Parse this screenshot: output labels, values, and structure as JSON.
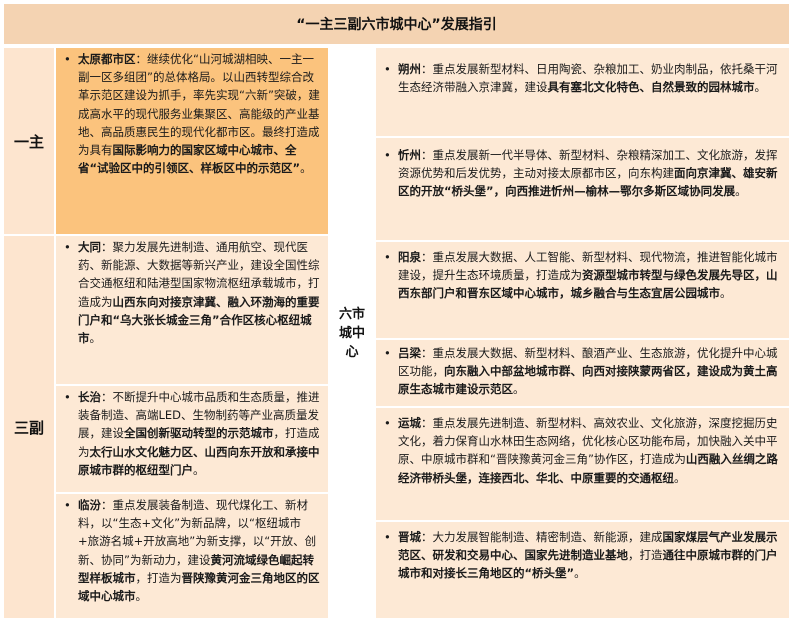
{
  "title": "“一主三副六市城中心”发展指引",
  "labels": {
    "yizhu": "一主",
    "sanfu": "三副",
    "liushi": [
      "六市",
      "城中",
      "心"
    ]
  },
  "bullet_char": "•",
  "cells": {
    "taiyuan": {
      "name": "太原都市区",
      "p1": "：继续优化“山河城湖相映、一主一副一区多组团”的总体格局。以山西转型综合改革示范区建设为抓手，率先实现“六新”突破，建成高水平的现代服务业集聚区、高能级的产业基地、高品质惠民生的现代化都市区。最终打造成为具有",
      "b1": "国际影响力的国家区域中心城市、全省“试验区中的引领区、样板区中的示范区”",
      "p2": "。"
    },
    "datong": {
      "name": "大同",
      "p1": "：聚力发展先进制造、通用航空、现代医药、新能源、大数据等新兴产业，建设全国性综合交通枢纽和陆港型国家物流枢纽承载城市，打造成为",
      "b1": "山西东向对接京津冀、融入环渤海的重要门户和“乌大张长城金三角”合作区核心枢纽城市",
      "p2": "。"
    },
    "changzhi": {
      "name": "长治",
      "p1": "：不断提升中心城市品质和生态质量，推进装备制造、高端LED、生物制药等产业高质量发展，建设",
      "b1": "全国创新驱动转型的示范城市",
      "p2": "，打造成为",
      "b2": "太行山水文化魅力区、山西向东开放和承接中原城市群的枢纽型门户",
      "p3": "。"
    },
    "linfen": {
      "name": "临汾",
      "p1": "：重点发展装备制造、现代煤化工、新材料，以“生态+文化”为新品牌，以“枢纽城市+旅游名城+开放高地”为新支撑，以“开放、创新、协同”为新动力，建设",
      "b1": "黄河流域绿色崛起转型样板城市",
      "p2": "，打造为",
      "b2": "晋陕豫黄河金三角地区的区域中心城市",
      "p3": "。"
    },
    "shuozhou": {
      "name": "朔州",
      "p1": "：重点发展新型材料、日用陶瓷、杂粮加工、奶业肉制品，依托桑干河生态经济带融入京津冀，建设",
      "b1": "具有塞北文化特色、自然景致的园林城市",
      "p2": "。"
    },
    "xinzhou": {
      "name": "忻州",
      "p1": "：重点发展新一代半导体、新型材料、杂粮精深加工、文化旅游，发挥资源优势和后发优势，主动对接太原都市区，向东构建",
      "b1": "面向京津冀、雄安新区的开放“桥头堡”，向西推进忻州—榆林—鄂尔多斯区域协同发展",
      "p2": "。"
    },
    "yangquan": {
      "name": "阳泉",
      "p1": "：重点发展大数据、人工智能、新型材料、现代物流，推进智能化城市建设，提升生态环境质量，打造成为",
      "b1": "资源型城市转型与绿色发展先导区，山西东部门户和晋东区域中心城市，城乡融合与生态宜居公园城市",
      "p2": "。"
    },
    "lvliang": {
      "name": "吕梁",
      "p1": "：重点发展大数据、新型材料、酿酒产业、生态旅游，优化提升中心城区功能，",
      "b1": "向东融入中部盆地城市群、向西对接陕蒙两省区，建设成为黄土高原生态城市建设示范区",
      "p2": "。"
    },
    "yuncheng": {
      "name": "运城",
      "p1": "：重点发展先进制造、新型材料、高效农业、文化旅游，深度挖掘历史文化，着力保育山水林田生态网络，优化核心区功能布局，加快融入关中平原、中原城市群和“晋陕豫黄河金三角”协作区，打造成为",
      "b1": "山西融入丝绸之路经济带桥头堡，连接西北、华北、中原重要的交通枢纽",
      "p2": "。"
    },
    "jincheng": {
      "name": "晋城",
      "p1": "：大力发展智能制造、精密制造、新能源，建成",
      "b1": "国家煤层气产业发展示范区、研发和交易中心、国家先进制造业基地",
      "p2": "，打造",
      "b2": "通往中原城市群的门户城市和对接长三角地区的“桥头堡”",
      "p3": "。"
    }
  }
}
